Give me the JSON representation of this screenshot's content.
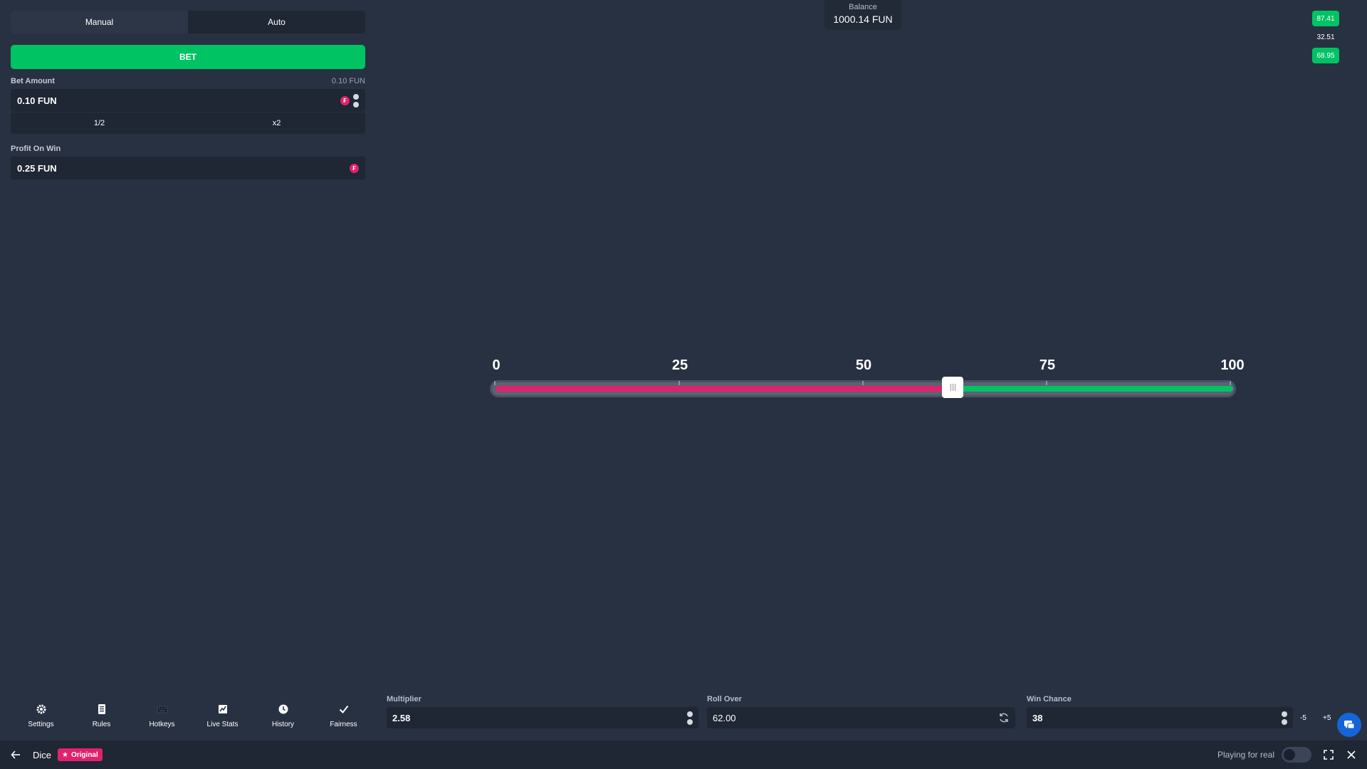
{
  "panel": {
    "tabs": [
      {
        "label": "Manual",
        "active": true
      },
      {
        "label": "Auto",
        "active": false
      }
    ],
    "bet_label": "BET",
    "bet_amount": {
      "label": "Bet Amount",
      "hint": "0.10 FUN",
      "value": "0.10 FUN"
    },
    "half_label": "1/2",
    "double_label": "x2",
    "profit": {
      "label": "Profit On Win",
      "value": "0.25 FUN"
    }
  },
  "balance": {
    "label": "Balance",
    "amount": "1000.14 FUN"
  },
  "results": [
    {
      "value": "87.41",
      "win": true
    },
    {
      "value": "32.51",
      "win": false
    },
    {
      "value": "68.95",
      "win": true
    }
  ],
  "slider": {
    "ticks": [
      "0",
      "25",
      "50",
      "75",
      "100"
    ],
    "min": 0,
    "max": 100,
    "roll_over": 62
  },
  "toolbar": [
    {
      "label": "Settings",
      "icon": "gear-icon"
    },
    {
      "label": "Rules",
      "icon": "document-icon"
    },
    {
      "label": "Hotkeys",
      "icon": "keyboard-icon"
    },
    {
      "label": "Live Stats",
      "icon": "chart-icon"
    },
    {
      "label": "History",
      "icon": "clock-icon"
    },
    {
      "label": "Fairness",
      "icon": "check-icon"
    }
  ],
  "fields": {
    "multiplier": {
      "label": "Multiplier",
      "value": "2.58"
    },
    "roll_over": {
      "label": "Roll Over",
      "value": "62.00"
    },
    "win_chance": {
      "label": "Win Chance",
      "value": "38"
    },
    "minus5": "-5",
    "plus5": "+5"
  },
  "footer": {
    "game_title": "Dice",
    "badge": "Original",
    "playing_label": "Playing for real"
  },
  "colors": {
    "win": "#00c364",
    "lose": "#e0226c",
    "bg": "#283142"
  }
}
